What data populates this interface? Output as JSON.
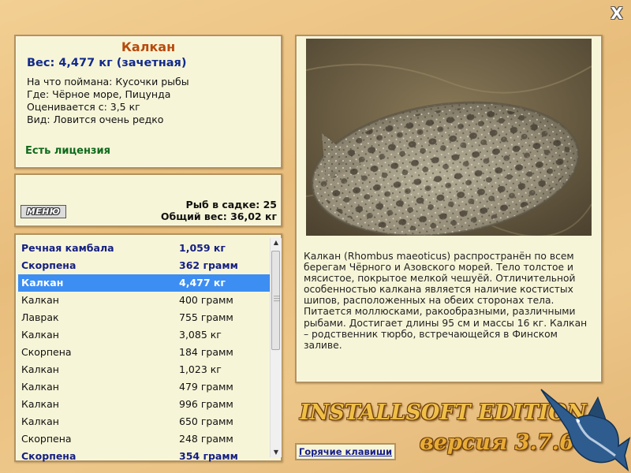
{
  "window": {
    "close_glyph": "X"
  },
  "info": {
    "title": "Калкан",
    "weight": "Вес: 4,477 кг (зачетная)",
    "details": [
      "На что поймана: Кусочки рыбы",
      "Где: Чёрное море, Пицунда",
      "Оценивается с: 3,5 кг",
      "Вид: Ловится очень редко"
    ],
    "license": "Есть лицензия"
  },
  "stats": {
    "menu_label": "МЕНЮ",
    "fish_count": "Рыб в садке: 25",
    "total_weight": "Общий вес: 36,02 кг"
  },
  "catch_list": [
    {
      "name": "Речная камбала",
      "weight": "1,059 кг",
      "bold": true
    },
    {
      "name": "Скорпена",
      "weight": "362 грамм",
      "bold": true
    },
    {
      "name": "Калкан",
      "weight": "4,477 кг",
      "bold": true,
      "selected": true
    },
    {
      "name": "Калкан",
      "weight": "400 грамм"
    },
    {
      "name": "Лаврак",
      "weight": "755 грамм"
    },
    {
      "name": "Калкан",
      "weight": "3,085 кг"
    },
    {
      "name": "Скорпена",
      "weight": "184 грамм"
    },
    {
      "name": "Калкан",
      "weight": "1,023 кг"
    },
    {
      "name": "Калкан",
      "weight": "479 грамм"
    },
    {
      "name": "Калкан",
      "weight": "996 грамм"
    },
    {
      "name": "Калкан",
      "weight": "650 грамм"
    },
    {
      "name": "Скорпена",
      "weight": "248 грамм"
    },
    {
      "name": "Скорпена",
      "weight": "354 грамм",
      "bold": true
    }
  ],
  "description": "Калкан (Rhombus maeoticus) распространён по всем берегам Чёрного и Азовского морей. Тело толстое и мясистое, покрытое мелкой чешуёй. Отличительной особенностью калкана является наличие костистых шипов, расположенных на обеих сторонах тела. Питается моллюсками, ракообразными, различными рыбами. Достигает длины 95 см и массы 16 кг. Калкан – родственник тюрбо, встречающейся в Финском заливе.",
  "footer": {
    "hotkeys_label": "Горячие клавиши",
    "brand": "INSTALLSOFT EDITION",
    "version": "версия 3.7.6"
  },
  "colors": {
    "selection": "#3d8ef2",
    "title": "#b84a0c",
    "weight": "#122a8a",
    "license": "#0f6a1c"
  },
  "icons": [
    "close-icon",
    "fish-photo",
    "marlin-logo"
  ]
}
